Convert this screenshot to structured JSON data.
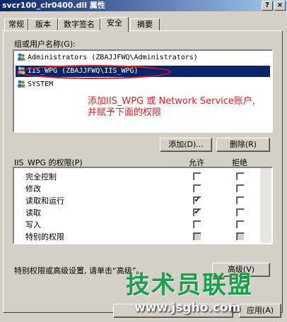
{
  "window": {
    "title": "svcr100_clr0400.dll 属性",
    "help_glyph": "?",
    "close_glyph": "×"
  },
  "tabs": [
    {
      "label": "常规"
    },
    {
      "label": "版本"
    },
    {
      "label": "数字签名"
    },
    {
      "label": "安全",
      "active": true
    },
    {
      "label": "摘要"
    }
  ],
  "groups": {
    "label": "组或用户名称(G):",
    "items": [
      {
        "name": "Administrators (ZBAJJFWQ\\Administrators)"
      },
      {
        "name": "IIS_WPG (ZBAJJFWQ\\IIS_WPG)",
        "selected": true
      },
      {
        "name": "SYSTEM"
      }
    ]
  },
  "annotation": {
    "line1": "添加IIS_WPG 或 Network Service账户,",
    "line2": "并赋予下面的权限",
    "color": "#e21e1e"
  },
  "buttons": {
    "add": "添加(D)...",
    "remove": "删除(R)",
    "advanced": "高级(V)",
    "apply": "应用(A)"
  },
  "permissions": {
    "label": "IIS_WPG 的权限(P)",
    "allow_header": "允许",
    "deny_header": "拒绝",
    "items": [
      {
        "name": "完全控制",
        "allow": false,
        "deny": false
      },
      {
        "name": "修改",
        "allow": false,
        "deny": false
      },
      {
        "name": "读取和运行",
        "allow": true,
        "deny": false
      },
      {
        "name": "读取",
        "allow": true,
        "deny": false
      },
      {
        "name": "写入",
        "allow": false,
        "deny": false
      },
      {
        "name": "特别的权限",
        "allow": false,
        "deny": false,
        "disabled": true
      }
    ]
  },
  "advanced_note": "特别权限或高级设置, 请单击“高级”。",
  "watermark": {
    "main": "技术员联盟",
    "url": "www.jsgho.com"
  }
}
